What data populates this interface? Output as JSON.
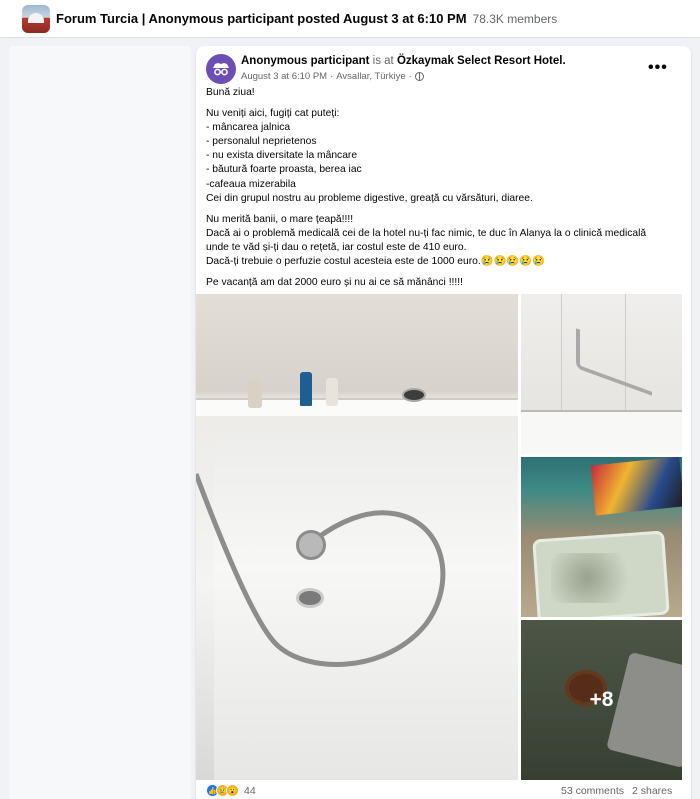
{
  "header": {
    "group_name": "Forum Turcia | Anonymous participant posted August 3 at 6:10 PM",
    "members": "78.3K members"
  },
  "post": {
    "author": "Anonymous participant",
    "is_at": "is at",
    "place": "Özkaymak Select Resort Hotel.",
    "date": "August 3 at 6:10 PM",
    "location": "Avsallar, Türkiye",
    "more_glyph": "•••",
    "lines": [
      "Bună ziua!",
      "Nu veniți aici, fugiți cat puteți:",
      "- mâncarea jalnica",
      "- personalul neprietenos",
      "- nu exista diversitate la mâncare",
      "- băutură foarte proasta, berea iac",
      "-cafeaua mizerabila",
      "Cei din grupul nostru au probleme digestive, greață cu vărsături, diaree.",
      "Nu merită banii, o mare țeapă!!!!",
      "Dacă ai o problemă medicală cei de la hotel nu-ți fac nimic, te duc în Alanya la o clinică medicală",
      "unde te văd și-ți dau o rețetă, iar costul este de 410 euro.",
      "Dacă-ți trebuie o perfuzie costul acesteia este de 1000 euro.😢😢😢😢😢",
      "Pe vacanță am dat 2000 euro și nu ai ce să mănânci !!!!!"
    ],
    "photos": {
      "more_overlay": "+8"
    },
    "footer": {
      "reaction_count": "44",
      "comments": "53 comments",
      "shares": "2 shares"
    }
  },
  "colors": {
    "background": "#f0f2f5",
    "card": "#ffffff",
    "secondary_text": "#65676b",
    "like_blue": "#1877f2",
    "avatar_purple": "#6d4fb3"
  }
}
